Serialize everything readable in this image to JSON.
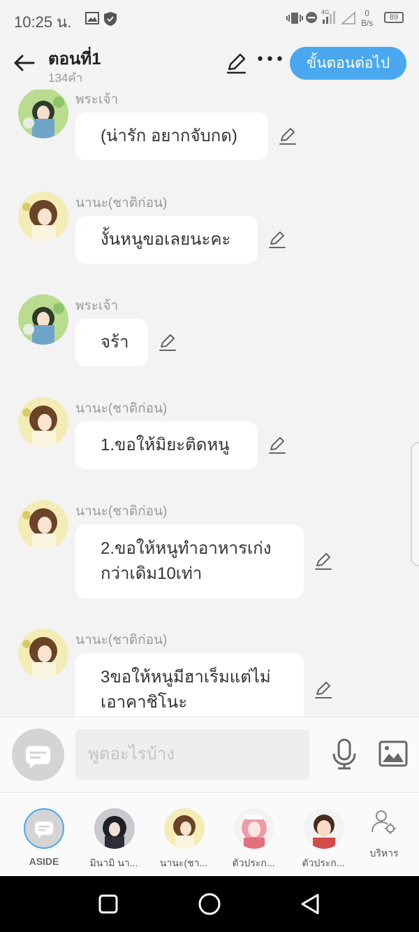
{
  "status_bar": {
    "time": "10:25 น.",
    "net_speed_value": "0",
    "net_speed_unit": "B/s",
    "network_type": "4G",
    "battery": "89"
  },
  "header": {
    "title": "ตอนที่1",
    "subtitle": "134คำ",
    "more_label": "•••",
    "next_button": "ขั้นตอนต่อไป"
  },
  "messages": [
    {
      "sender": "พระเจ้า",
      "text": "(น่ารัก อยากจับกด)"
    },
    {
      "sender": "นานะ(ชาติก่อน)",
      "text": "งั้นหนูขอเลยนะคะ"
    },
    {
      "sender": "พระเจ้า",
      "text": "จร้า"
    },
    {
      "sender": "นานะ(ชาติก่อน)",
      "text": "1.ขอให้มิยะติดหนู"
    },
    {
      "sender": "นานะ(ชาติก่อน)",
      "text": "2.ขอให้หนูทำอาหารเก่งกว่าเดิม10เท่า"
    },
    {
      "sender": "นานะ(ชาติก่อน)",
      "text": "3ขอให้หนูมีฮาเร็มแต่ไม่เอาคาชิโนะ"
    }
  ],
  "input": {
    "placeholder": "พูดอะไรบ้าง"
  },
  "characters": [
    {
      "label": "ASIDE"
    },
    {
      "label": "มินามิ นา..."
    },
    {
      "label": "นานะ(ชา..."
    },
    {
      "label": "ตัวประก..."
    },
    {
      "label": "ตัวประก..."
    },
    {
      "label": "บริหาร"
    }
  ],
  "colors": {
    "accent": "#4aa8f0",
    "background": "#f3f3f3",
    "bubble": "#ffffff",
    "sender_text": "#9a9a9a"
  }
}
